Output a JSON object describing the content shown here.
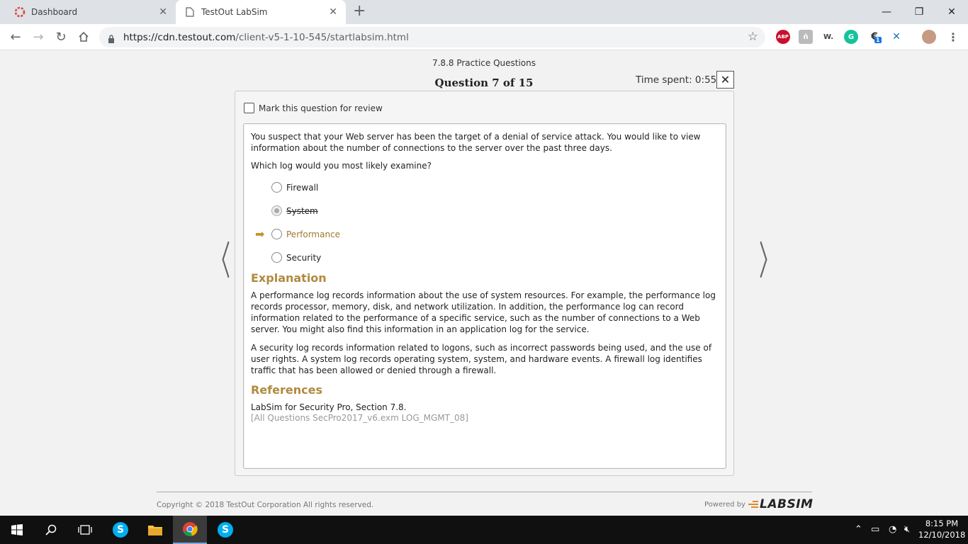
{
  "browser": {
    "tabs": [
      {
        "title": "Dashboard",
        "active": false
      },
      {
        "title": "TestOut LabSim",
        "active": true
      }
    ],
    "url_host": "https://cdn.testout.com",
    "url_path": "/client-v5-1-10-545/startlabsim.html",
    "extensions": [
      "adblock-plus-icon",
      "extension-icon",
      "wikiwand-icon",
      "grammarly-icon",
      "extension-badge-icon",
      "xtension-icon",
      "profile-avatar"
    ],
    "extension_badge_count": "1",
    "extension_labels": {
      "abp": "ABP",
      "w": "W."
    }
  },
  "exam": {
    "title": "7.8.8 Practice Questions",
    "question_number": "Question 7 of 15",
    "time_spent": "Time spent: 0:55",
    "mark_review_label": "Mark this question for review",
    "question_text": "You suspect that your Web server has been the target of a denial of service attack. You would like to view information about the number of connections to the server over the past three days.",
    "question_ask": "Which log would you most likely examine?",
    "options": [
      {
        "label": "Firewall"
      },
      {
        "label": "System",
        "selected": true,
        "incorrect": true
      },
      {
        "label": "Performance",
        "correct": true
      },
      {
        "label": "Security"
      }
    ],
    "explanation_heading": "Explanation",
    "explanation_p1": "A performance log records information about the use of system resources. For example, the performance log records processor, memory, disk, and network utilization. In addition, the performance log can record information related to the performance of a specific service, such as the number of connections to a Web server. You might also find this information in an application log for the service.",
    "explanation_p2": "A security log records information related to logons, such as incorrect passwords being used, and the use of user rights. A system log records operating system, system, and hardware events. A firewall log identifies traffic that has been allowed or denied through a firewall.",
    "references_heading": "References",
    "reference": "LabSim for Security Pro, Section 7.8.",
    "reference_id": "[All Questions SecPro2017_v6.exm LOG_MGMT_08]"
  },
  "footer": {
    "copyright": "Copyright © 2018  TestOut Corporation All rights reserved.",
    "powered_by": "Powered by",
    "logo_text": "LABSIM"
  },
  "taskbar": {
    "time": "8:15 PM",
    "date": "12/10/2018"
  },
  "colors": {
    "accent_gold": "#b08a3e",
    "arrow": "#c4922c"
  }
}
